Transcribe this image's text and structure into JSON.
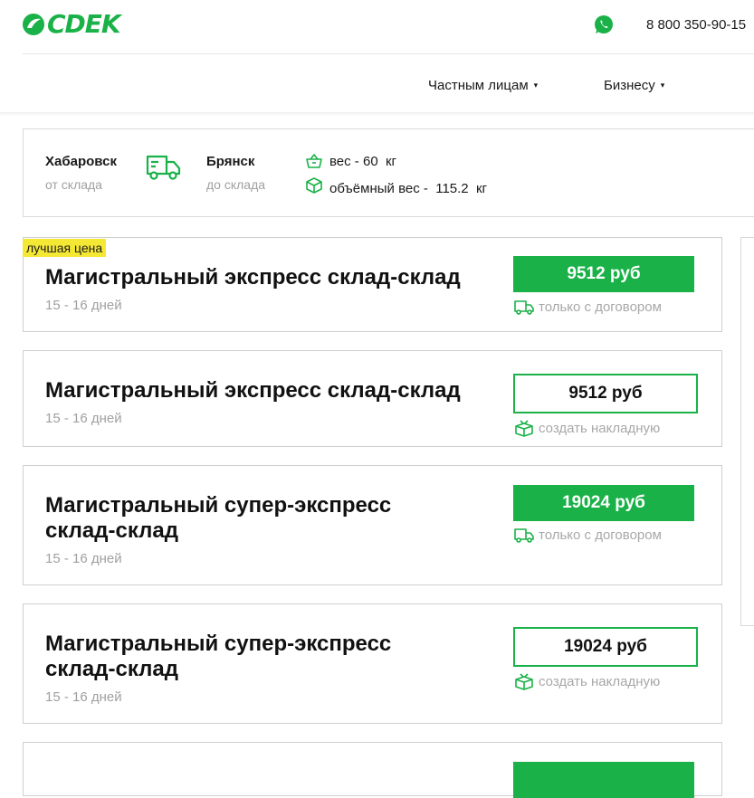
{
  "header": {
    "logo_text": "CDEK",
    "phone": "8 800 350-90-15",
    "nav": [
      {
        "label": "Частным лицам"
      },
      {
        "label": "Бизнесу"
      }
    ],
    "caret": "▾"
  },
  "route": {
    "from_city": "Хабаровск",
    "from_sub": "от склада",
    "to_city": "Брянск",
    "to_sub": "до склада",
    "weight_line": "вес - 60  кг",
    "volume_line": "объёмный вес -  115.2  кг"
  },
  "colors": {
    "brand_green": "#1ab248",
    "badge_yellow": "#f5e834"
  },
  "tariffs": [
    {
      "badge": "лучшая цена",
      "title": "Магистральный экспресс склад-склад",
      "days": "15 - 16 дней",
      "price": "9512 руб",
      "note": "только с договором",
      "note_icon": "truck-icon"
    },
    {
      "title": "Магистральный экспресс склад-склад",
      "days": "15 - 16 дней",
      "price": "9512 руб",
      "note": "создать накладную",
      "note_icon": "box-icon"
    },
    {
      "title_line1": "Магистральный супер-экспресс",
      "title_line2": "склад-склад",
      "days": "15 - 16 дней",
      "price": "19024 руб",
      "note": "только с договором",
      "note_icon": "truck-icon"
    },
    {
      "title_line1": "Магистральный супер-экспресс",
      "title_line2": "склад-склад",
      "days": "15 - 16 дней",
      "price": "19024 руб",
      "note": "создать накладную",
      "note_icon": "box-icon"
    }
  ]
}
